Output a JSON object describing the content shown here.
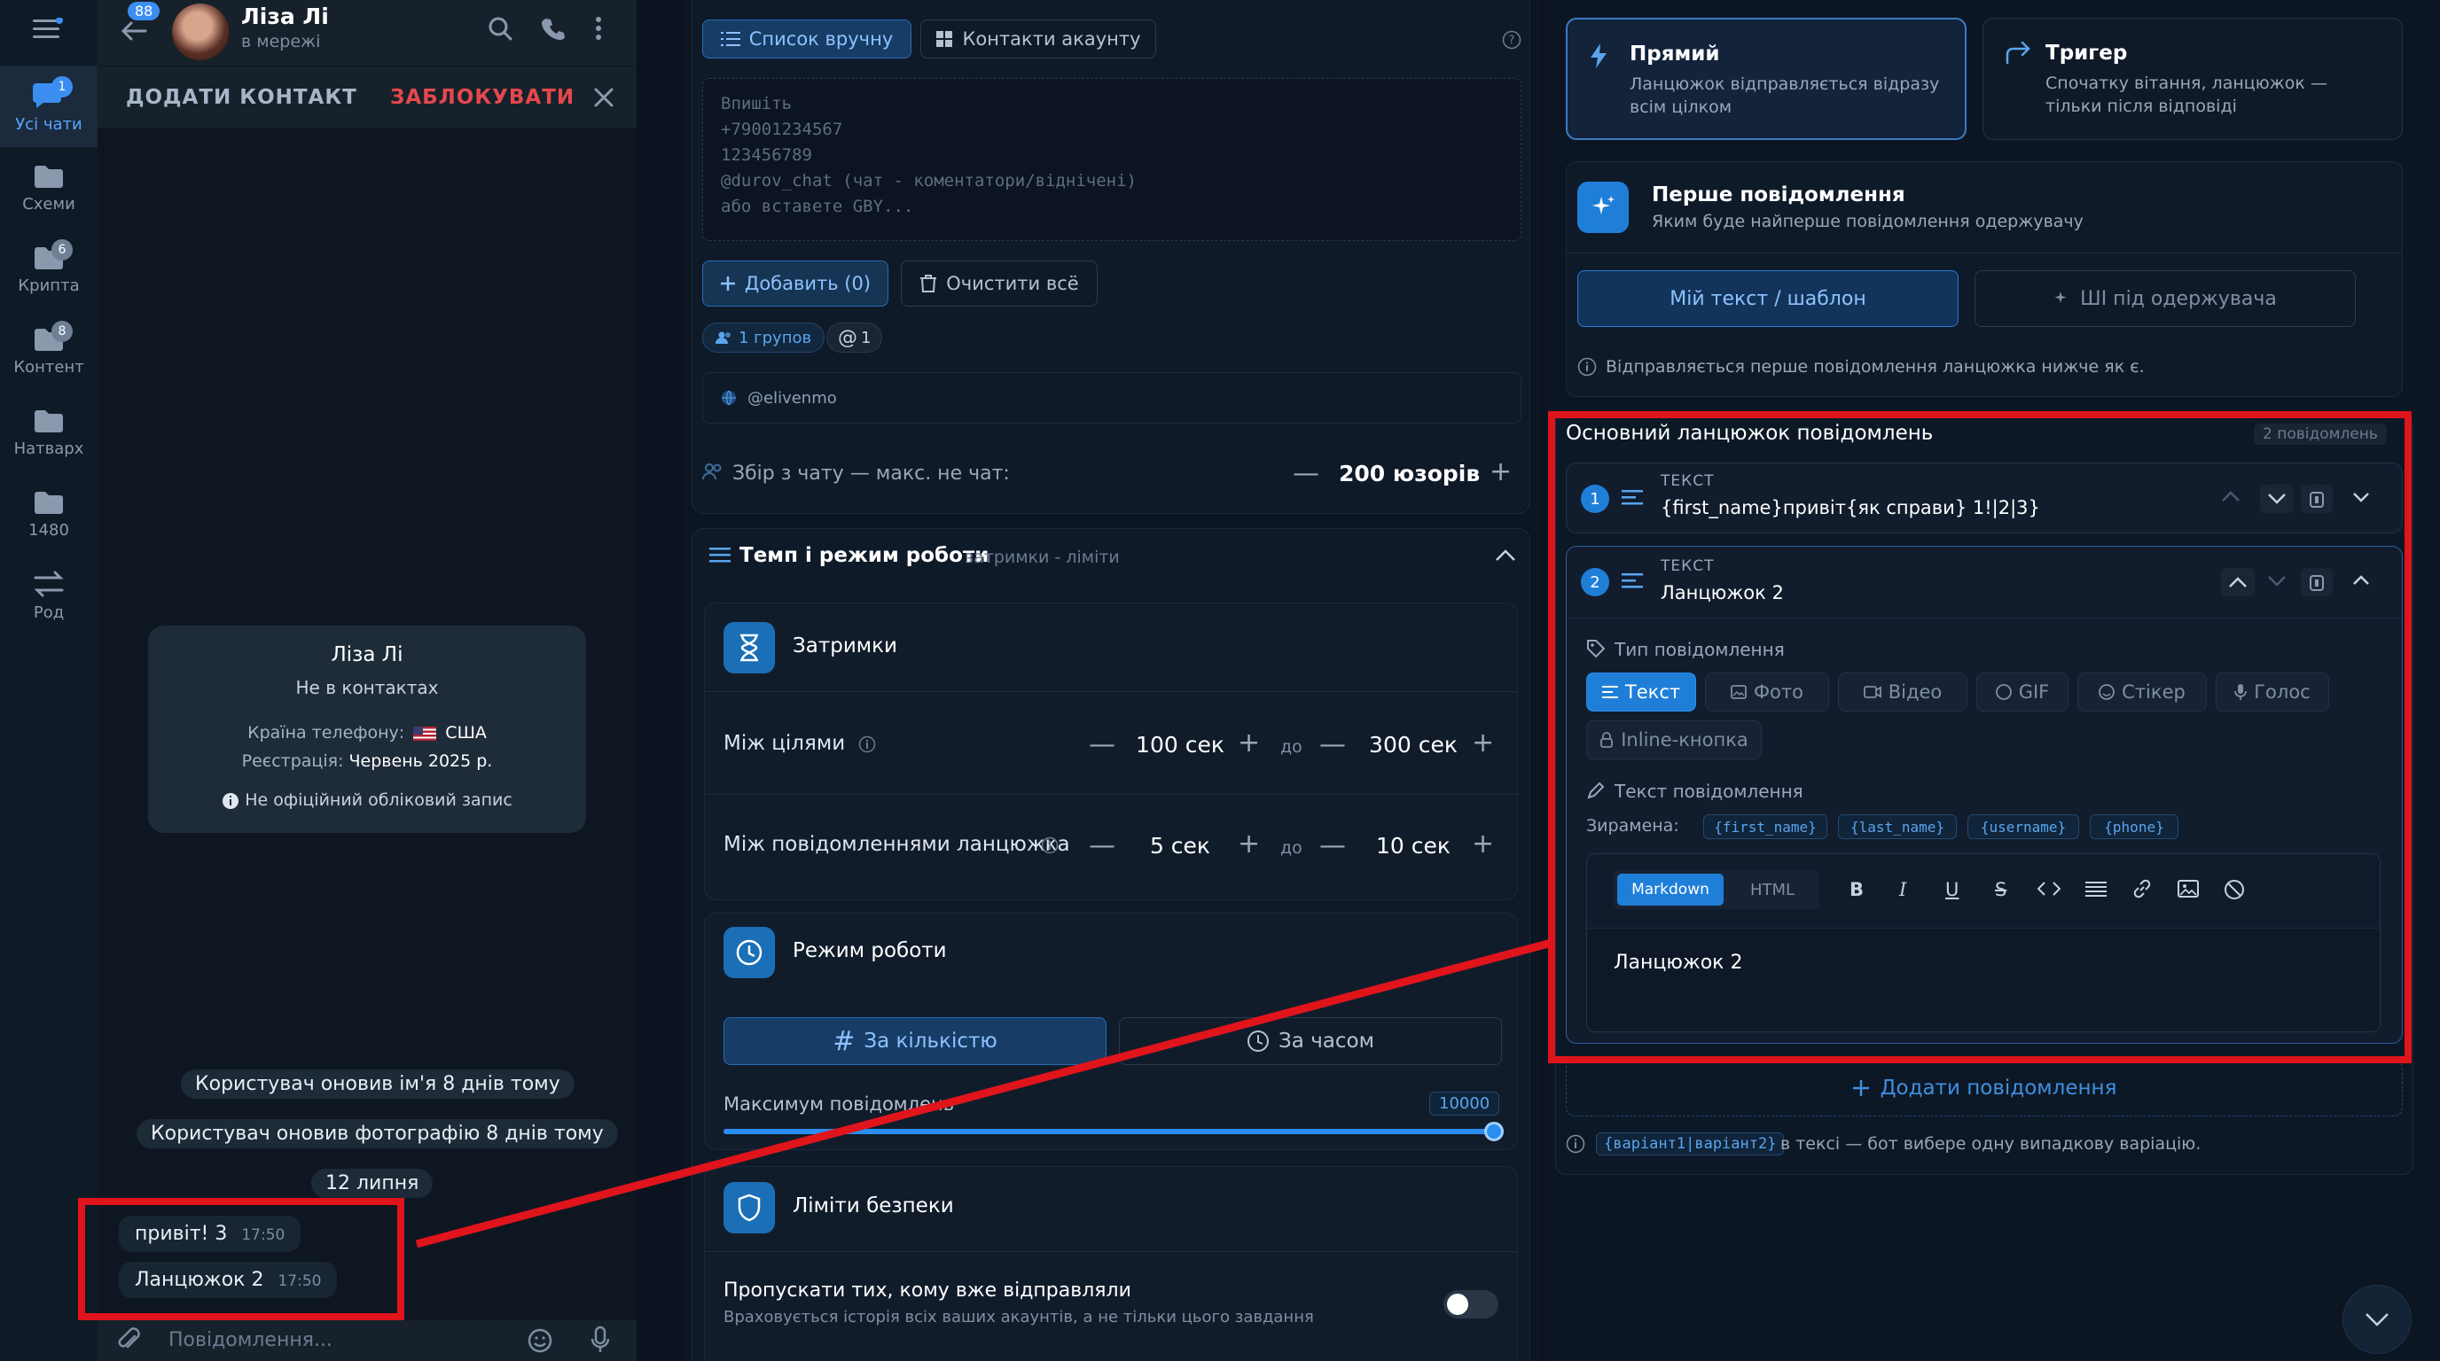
{
  "rail": {
    "items": [
      {
        "label": "Усі чати",
        "badge": "1"
      },
      {
        "label": "Схеми",
        "badge": ""
      },
      {
        "label": "Крипта",
        "badge": "6"
      },
      {
        "label": "Контент",
        "badge": "8"
      },
      {
        "label": "Натварх",
        "badge": ""
      },
      {
        "label": "1480",
        "badge": ""
      },
      {
        "label": "Род",
        "badge": ""
      }
    ],
    "back_badge": "88"
  },
  "chat": {
    "name": "Ліза Лі",
    "status": "в мережі",
    "add_contact": "ДОДАТИ КОНТАКТ",
    "block": "ЗАБЛОКУВАТИ",
    "card": {
      "name": "Ліза Лі",
      "contact_status": "Не в контактах",
      "country_label": "Країна телефону:",
      "country_value": "США",
      "reg_label": "Реєстрація:",
      "reg_value": "Червень 2025 р.",
      "unofficial": "Не офіційний обліковий запис"
    },
    "service_1": "Користувач оновив ім'я 8 днів тому",
    "service_2": "Користувач оновив фотографію 8 днів тому",
    "date": "12 липня",
    "messages": [
      {
        "text": "привіт! 3",
        "time": "17:50"
      },
      {
        "text": "Ланцюжок 2",
        "time": "17:50"
      }
    ],
    "composer_placeholder": "Повідомлення..."
  },
  "mid": {
    "tab_manual": "Список вручну",
    "tab_contacts": "Контакти акаунту",
    "textarea_placeholder_lines": [
      "Впишіть",
      "+79001234567",
      "123456789",
      "@durov_chat (чат - коментатори/відніченi)",
      "або вставете GBY..."
    ],
    "add_btn": "Добавить (0)",
    "clear_btn": "Очистити всё",
    "chip_group": "1 групов",
    "chip_at": "1",
    "user_handle": "@elivenmo",
    "collect_label": "Збір з чату — макс. не чат:",
    "collect_value": "200 юзорів",
    "tempo_title": "Темп і режим роботи",
    "tempo_sub": "затримки - ліміти",
    "delays_title": "Затримки",
    "between_targets": "Між цілями",
    "bt_from": "100 сек",
    "bt_to": "300 сек",
    "between_chain": "Між повідомленнями ланцюжка",
    "bc_from": "5 сек",
    "bc_to": "10 сек",
    "to_word": "до",
    "mode_title": "Режим роботи",
    "mode_by_count": "За кількістю",
    "mode_by_time": "За часом",
    "max_messages": "Максимум повідомлень",
    "max_value": "10000",
    "max_fraction": 1.0,
    "safety_title": "Ліміти безпеки",
    "skip_title": "Пропускати тих, кому вже відправляли",
    "skip_sub": "Враховується історія всіх ваших акаунтів, а не тільки цього завдання"
  },
  "right": {
    "direct_title": "Прямий",
    "direct_sub_1": "Ланцюжок відправляється відразу",
    "direct_sub_2": "всім цілком",
    "trigger_title": "Тригер",
    "trigger_sub_1": "Спочатку вітання, ланцюжок —",
    "trigger_sub_2": "тільки після відповіді",
    "first_title": "Перше повідомлення",
    "first_sub": "Яким буде найперше повідомлення одержувачу",
    "my_text": "Мій текст / шаблон",
    "ai_text": "ШІ під одержувача",
    "first_note": "Відправляється перше повідомлення ланцюжка нижче як є.",
    "chain_title": "Основний ланцюжок повідомлень",
    "chain_count": "2 повідомлень",
    "msg1_type": "ТЕКСТ",
    "msg1_text": "{first_name}привіт{як справи} 1!|2|3}",
    "msg2_type": "ТЕКСТ",
    "msg2_text": "Ланцюжок 2",
    "type_label": "Тип повідомлення",
    "types": [
      "Текст",
      "Фото",
      "Відео",
      "GIF",
      "Стікер",
      "Голос"
    ],
    "inline_btn": "Inline-кнопка",
    "text_label": "Текст повідомлення",
    "vars_label": "Зирамена:",
    "vars": [
      "{first_name}",
      "{last_name}",
      "{username}",
      "{phone}"
    ],
    "fmt_markdown": "Markdown",
    "fmt_html": "HTML",
    "editor_text": "Ланцюжок 2",
    "add_message": "Додати повідомлення",
    "footer_var": "{варіант1|варіант2}",
    "footer_text": "в тексі — бот вибере одну випадкову варіацію."
  },
  "colors": {
    "accent": "#1f7fd8",
    "highlight_red": "#e0141b",
    "block_red": "#e5484d"
  }
}
